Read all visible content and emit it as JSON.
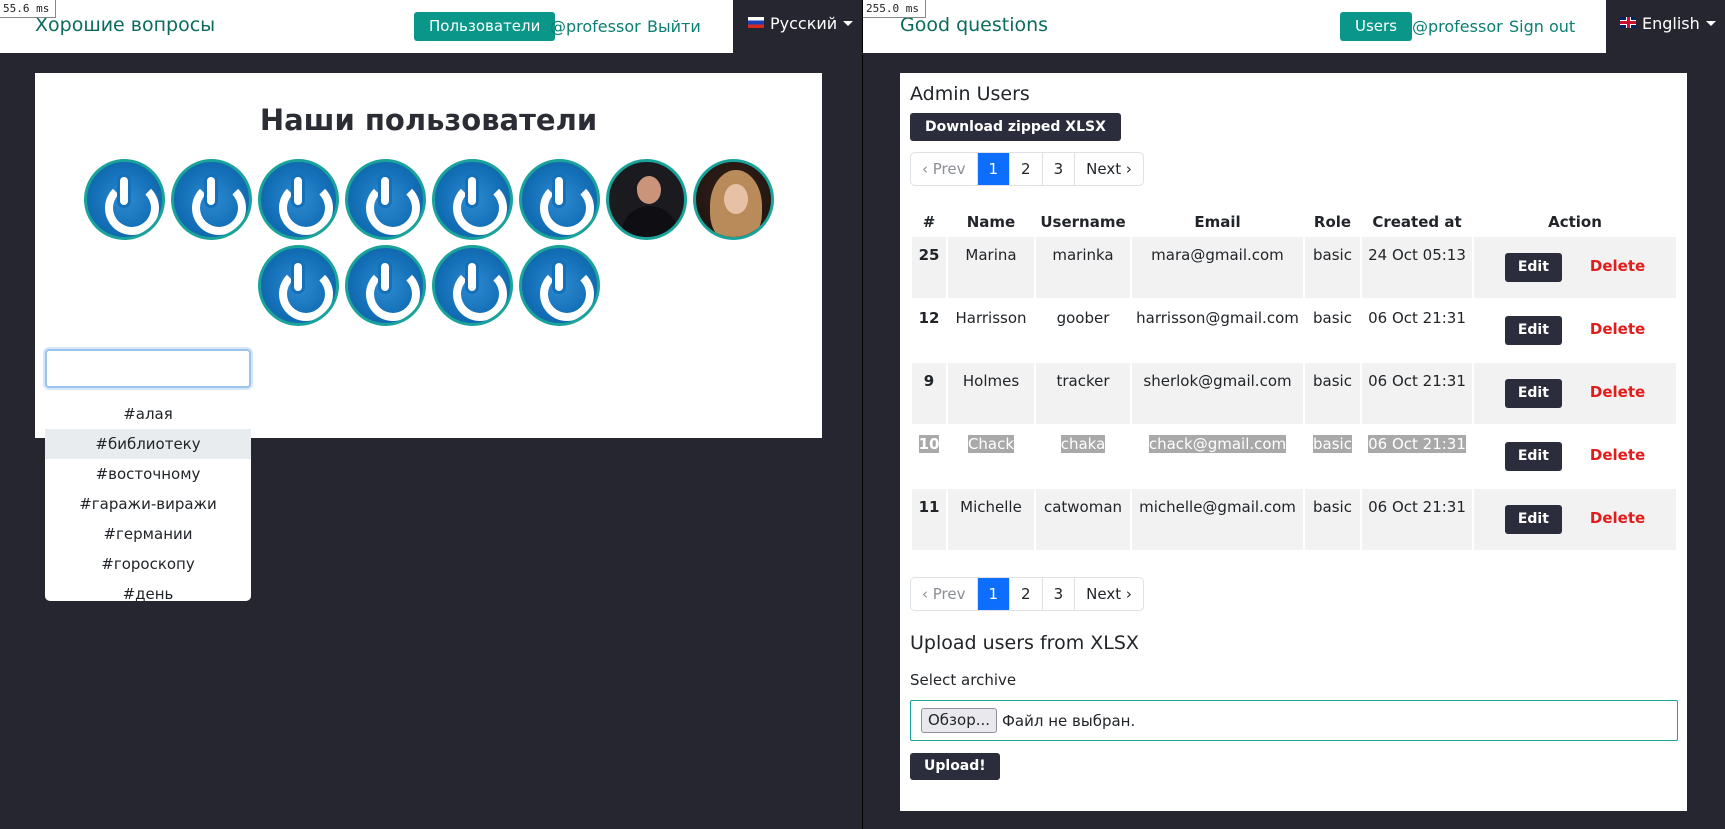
{
  "left": {
    "timing": "55.6 ms",
    "brand": "Хорошие вопросы",
    "nav": {
      "users": "Пользователи",
      "profile": "@professor",
      "logout": "Выйти"
    },
    "language": "Русский",
    "page_title": "Наши пользователи",
    "avatars_row1": [
      "power-icon",
      "power-icon",
      "power-icon",
      "power-icon",
      "power-icon",
      "power-icon",
      "photo",
      "photo"
    ],
    "avatars_row2": [
      "power-icon",
      "power-icon",
      "power-icon",
      "power-icon"
    ],
    "search": {
      "value": ""
    },
    "suggestions": [
      "#алая",
      "#библиотеку",
      "#восточному",
      "#гаражи-виражи",
      "#германии",
      "#гороскопу",
      "#день"
    ]
  },
  "right": {
    "timing": "255.0 ms",
    "brand": "Good questions",
    "nav": {
      "users": "Users",
      "profile": "@professor",
      "logout": "Sign out"
    },
    "language": "English",
    "admin_title": "Admin Users",
    "download_label": "Download zipped XLSX",
    "pager": {
      "prev": "‹ Prev",
      "pages": [
        "1",
        "2",
        "3"
      ],
      "next": "Next ›"
    },
    "table": {
      "headers": [
        "#",
        "Name",
        "Username",
        "Email",
        "Role",
        "Created at",
        "Action"
      ],
      "rows": [
        {
          "id": "25",
          "name": "Marina",
          "username": "marinka",
          "email": "mara@gmail.com",
          "role": "basic",
          "created": "24 Oct 05:13"
        },
        {
          "id": "12",
          "name": "Harrisson",
          "username": "goober",
          "email": "harrisson@gmail.com",
          "role": "basic",
          "created": "06 Oct 21:31"
        },
        {
          "id": "9",
          "name": "Holmes",
          "username": "tracker",
          "email": "sherlok@gmail.com",
          "role": "basic",
          "created": "06 Oct 21:31"
        },
        {
          "id": "10",
          "name": "Chack",
          "username": "chaka",
          "email": "chack@gmail.com",
          "role": "basic",
          "created": "06 Oct 21:31"
        },
        {
          "id": "11",
          "name": "Michelle",
          "username": "catwoman",
          "email": "michelle@gmail.com",
          "role": "basic",
          "created": "06 Oct 21:31"
        }
      ],
      "edit_label": "Edit",
      "delete_label": "Delete"
    },
    "upload_title": "Upload users from XLSX",
    "select_label": "Select archive",
    "browse_label": "Обзор...",
    "file_status": "Файл не выбран.",
    "upload_label": "Upload!"
  },
  "colors": {
    "accent": "#0a978a",
    "dark": "#2b2d3d",
    "danger": "#e41b1b",
    "page_bg": "#25262f",
    "pager_active": "#0d6efd"
  }
}
